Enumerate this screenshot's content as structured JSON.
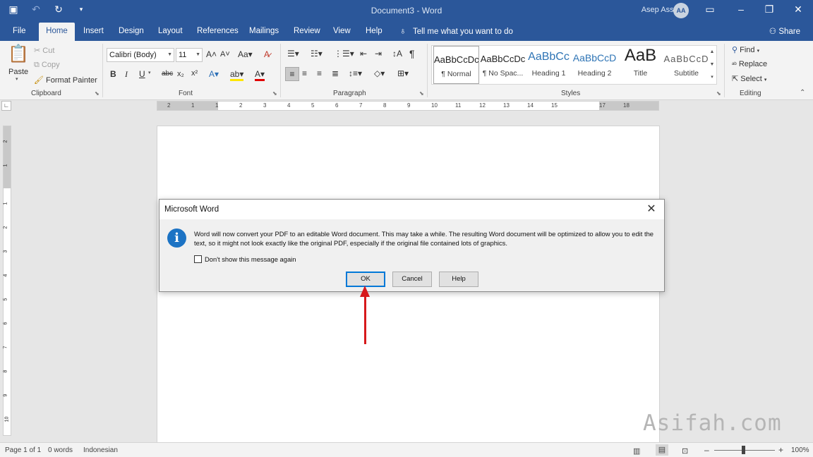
{
  "titlebar": {
    "document_title": "Document3",
    "separator": "-",
    "app_name": "Word",
    "user_name": "Asep Assafah",
    "user_initials": "AA"
  },
  "tabs": [
    "File",
    "Home",
    "Insert",
    "Design",
    "Layout",
    "References",
    "Mailings",
    "Review",
    "View",
    "Help"
  ],
  "tell_me": "Tell me what you want to do",
  "share": "Share",
  "clipboard": {
    "paste": "Paste",
    "cut": "Cut",
    "copy": "Copy",
    "format_painter": "Format Painter",
    "label": "Clipboard"
  },
  "font": {
    "family": "Calibri (Body)",
    "size": "11",
    "label": "Font"
  },
  "paragraph": {
    "label": "Paragraph"
  },
  "styles": {
    "label": "Styles",
    "items": [
      {
        "sample": "AaBbCcDc",
        "name": "¶ Normal"
      },
      {
        "sample": "AaBbCcDc",
        "name": "¶ No Spac..."
      },
      {
        "sample": "AaBbCc",
        "name": "Heading 1"
      },
      {
        "sample": "AaBbCcD",
        "name": "Heading 2"
      },
      {
        "sample": "AaB",
        "name": "Title"
      },
      {
        "sample": "AaBbCcD",
        "name": "Subtitle"
      }
    ]
  },
  "editing": {
    "find": "Find",
    "replace": "Replace",
    "select": "Select",
    "label": "Editing"
  },
  "ruler": {
    "labels": [
      "2",
      "1",
      "1",
      "2",
      "3",
      "4",
      "5",
      "6",
      "7",
      "8",
      "9",
      "10",
      "11",
      "12",
      "13",
      "14",
      "15",
      "17",
      "18"
    ],
    "vertical_labels": [
      "2",
      "1",
      "1",
      "2",
      "3",
      "4",
      "5",
      "6",
      "7",
      "8",
      "9",
      "10"
    ]
  },
  "dialog": {
    "title": "Microsoft Word",
    "message": "Word will now convert your PDF to an editable Word document. This may take a while. The resulting Word document will be optimized to allow you to edit the text, so it might not look exactly like the original PDF, especially if the original file contained lots of graphics.",
    "checkbox_label": "Don't show this message again",
    "checkbox_checked": false,
    "ok": "OK",
    "cancel": "Cancel",
    "help": "Help"
  },
  "annotation": {
    "arrow_color": "#d7191c"
  },
  "watermark": "Asifah.com",
  "statusbar": {
    "page": "Page 1 of 1",
    "words": "0 words",
    "language": "Indonesian",
    "zoom": "100%"
  },
  "colors": {
    "brand": "#2b579a",
    "ribbon": "#f3f3f3",
    "info_icon": "#1c73c4",
    "ok_focus": "#0078d7"
  }
}
